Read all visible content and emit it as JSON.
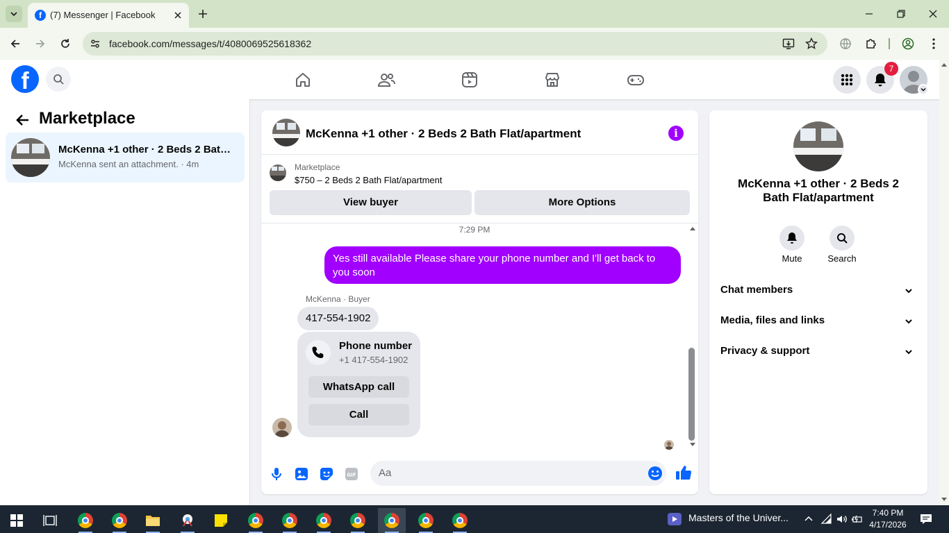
{
  "browser": {
    "tab_title": "(7) Messenger | Facebook",
    "url": "facebook.com/messages/t/4080069525618362"
  },
  "fb": {
    "logo_letter": "f",
    "notification_count": "7"
  },
  "left_panel": {
    "title": "Marketplace",
    "conversation": {
      "title": "McKenna +1 other · 2 Beds 2 Bath Flat/apartment",
      "subtitle": "McKenna sent an attachment. · 4m"
    }
  },
  "chat": {
    "header_title": "McKenna +1 other · 2 Beds 2 Bath Flat/apartment",
    "info_letter": "i",
    "marketplace_label": "Marketplace",
    "listing": "$750 – 2 Beds 2 Bath Flat/apartment",
    "view_buyer_label": "View buyer",
    "more_options_label": "More Options",
    "timestamp": "7:29 PM",
    "messages": [
      {
        "from": "me",
        "text": "Yes still available Please share your phone number and I'll get back to you soon"
      },
      {
        "from": "buyer",
        "sender_label": "McKenna · Buyer",
        "text": "417-554-1902"
      }
    ],
    "phone_card": {
      "title": "Phone number",
      "number": "+1 417-554-1902",
      "whatsapp_label": "WhatsApp call",
      "call_label": "Call"
    },
    "input_placeholder": "Aa"
  },
  "right_panel": {
    "title": "McKenna +1 other · 2 Beds 2 Bath Flat/apartment",
    "mute_label": "Mute",
    "search_label": "Search",
    "sections": [
      "Chat members",
      "Media, files and links",
      "Privacy & support"
    ]
  },
  "taskbar": {
    "media_title": "Masters of the Univer...",
    "time": "7:40 PM",
    "date": "4/17/2026"
  },
  "colors": {
    "accent": "#a100ff",
    "fb_blue": "#0866ff",
    "taskbar": "#1c2632"
  }
}
